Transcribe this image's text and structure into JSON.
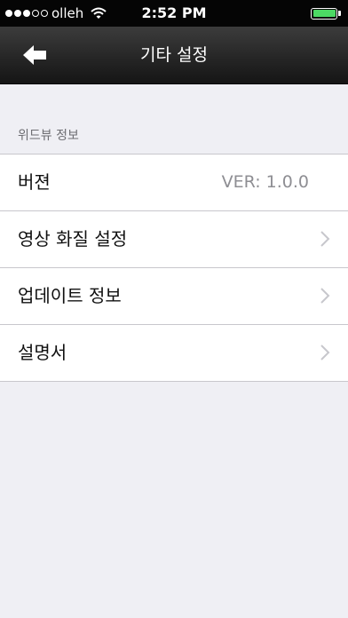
{
  "status_bar": {
    "signal_bars": 3,
    "signal_total": 5,
    "carrier": "olleh",
    "time": "2:52 PM",
    "battery_level": 1.0,
    "battery_color": "#4cd964"
  },
  "nav": {
    "back_icon": "back-arrow-icon",
    "title": "기타 설정"
  },
  "section": {
    "header": "위드뷰 정보"
  },
  "rows": [
    {
      "label": "버젼",
      "value": "VER: 1.0.0"
    },
    {
      "label": "영상 화질 설정",
      "icon": "chevron-right-icon"
    },
    {
      "label": "업데이트 정보",
      "icon": "chevron-right-icon"
    },
    {
      "label": "설명서",
      "icon": "chevron-right-icon"
    }
  ]
}
